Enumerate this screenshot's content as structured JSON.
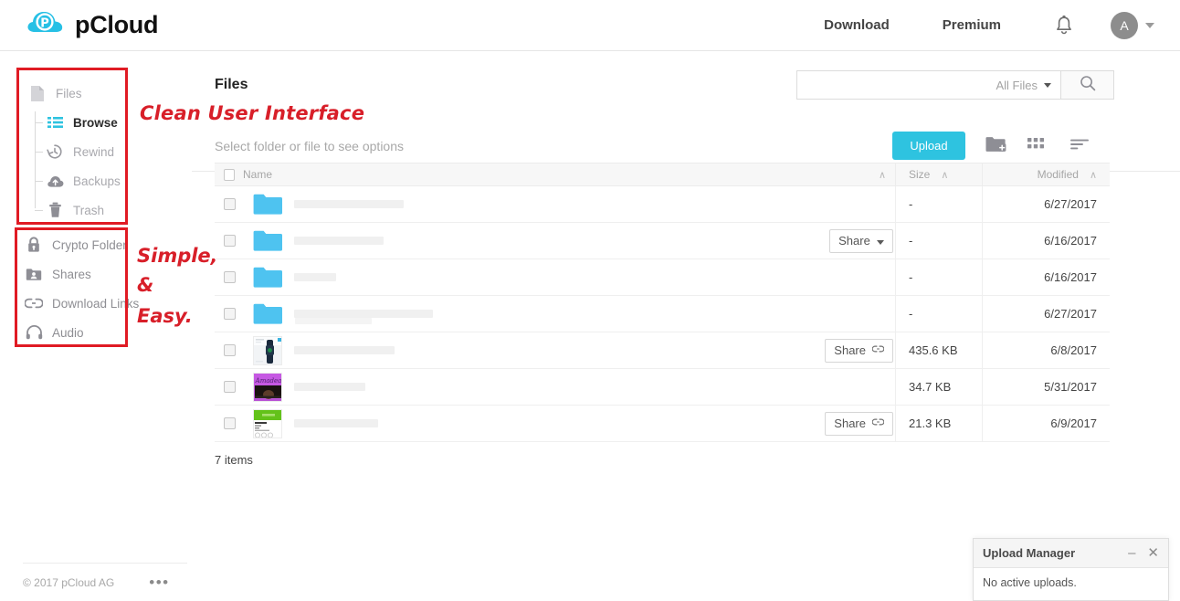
{
  "header": {
    "brand": "pCloud",
    "nav": [
      {
        "label": "Download",
        "name": "nav-download"
      },
      {
        "label": "Premium",
        "name": "nav-premium"
      }
    ],
    "notifications_icon": "bell-icon",
    "avatar_initial": "A"
  },
  "sidebar": {
    "files_group": {
      "root_label": "Files",
      "items": [
        {
          "label": "Browse",
          "icon": "list-icon",
          "active": true
        },
        {
          "label": "Rewind",
          "icon": "rewind-clock-icon",
          "active": false
        },
        {
          "label": "Backups",
          "icon": "cloud-upload-icon",
          "active": false
        },
        {
          "label": "Trash",
          "icon": "trash-icon",
          "active": false
        }
      ]
    },
    "tools_group": {
      "items": [
        {
          "label": "Crypto Folder",
          "icon": "lock-icon"
        },
        {
          "label": "Shares",
          "icon": "shared-folder-icon"
        },
        {
          "label": "Download Links",
          "icon": "link-icon"
        },
        {
          "label": "Audio",
          "icon": "headphones-icon"
        }
      ]
    }
  },
  "annotations": {
    "clean_ui": "Clean User Interface",
    "simple": "Simple,",
    "amp": "&",
    "easy": "Easy."
  },
  "main": {
    "page_title": "Files",
    "search": {
      "value": "",
      "placeholder": "",
      "filter_label": "All Files",
      "search_icon": "magnifier-icon"
    },
    "hint": "Select folder or file to see options",
    "toolbar": {
      "upload_label": "Upload",
      "new_folder_icon": "new-folder-icon",
      "grid_view_icon": "grid-view-icon",
      "sort_icon": "sort-icon"
    },
    "table": {
      "columns": [
        {
          "label": "Name",
          "sort_glyph": "∧"
        },
        {
          "label": "Size",
          "sort_glyph": "∧"
        },
        {
          "label": "Modified",
          "sort_glyph": "∧"
        }
      ],
      "rows": [
        {
          "kind": "folder",
          "name": "",
          "name_w": 120,
          "size": "-",
          "modified": "6/27/2017",
          "share": null
        },
        {
          "kind": "folder",
          "name": "",
          "name_w": 98,
          "size": "-",
          "modified": "6/16/2017",
          "share": {
            "label": "Share",
            "icon": "chevron-down-icon"
          }
        },
        {
          "kind": "folder",
          "name": "",
          "name_w": 46,
          "size": "-",
          "modified": "6/16/2017",
          "share": null
        },
        {
          "kind": "folder",
          "name": "",
          "name_w": 152,
          "size": "-",
          "modified": "6/27/2017",
          "share": null
        },
        {
          "kind": "image-watch",
          "name": "",
          "name_w": 110,
          "size": "435.6 KB",
          "modified": "6/8/2017",
          "share": {
            "label": "Share",
            "icon": "link-icon"
          }
        },
        {
          "kind": "image-purple",
          "name": "",
          "name_w": 78,
          "size": "34.7 KB",
          "modified": "5/31/2017",
          "share": null
        },
        {
          "kind": "image-green",
          "name": "",
          "name_w": 92,
          "size": "21.3 KB",
          "modified": "6/9/2017",
          "share": {
            "label": "Share",
            "icon": "link-icon"
          }
        }
      ],
      "items_count": "7 items"
    }
  },
  "footer": {
    "copyright": "© 2017 pCloud AG",
    "more_icon": "more-dots-icon"
  },
  "upload_manager": {
    "title": "Upload Manager",
    "minimize_icon": "minimize-icon",
    "close_icon": "close-icon",
    "status": "No active uploads."
  },
  "colors": {
    "brand_cyan": "#2ec3e0",
    "annotation_red": "#d81f29",
    "box_red": "#e01b24",
    "folder_blue": "#4ec3f0"
  }
}
